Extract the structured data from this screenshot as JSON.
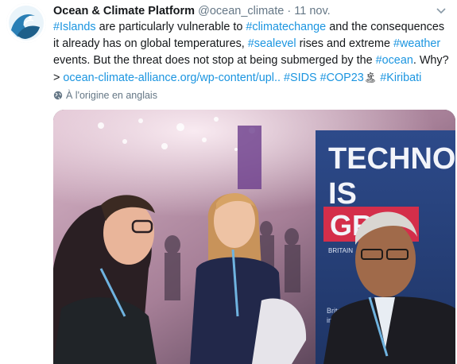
{
  "tweet": {
    "author_name": "Ocean & Climate Platform",
    "handle": "@ocean_climate",
    "separator": "·",
    "date": "11 nov.",
    "caret_icon": "chevron-down-icon",
    "text": {
      "t1": "#Islands",
      "t2": " are particularly vulnerable to ",
      "t3": "#climatechange",
      "t4": " and the consequences it already has on global temperatures, ",
      "t5": "#sealevel",
      "t6": " rises and extreme ",
      "t7": "#weather",
      "t8": " events. But the threat does not stop at being submerged by the ",
      "t9": "#ocean",
      "t10": ". Why? > ",
      "t11": "ocean-climate-alliance.org/wp-content/upl..",
      "t12": " ",
      "t13": "#SIDS",
      "t14": " ",
      "t15": "#COP23",
      "t16": "🏝",
      "t17": " ",
      "t18": "#Kiribati"
    },
    "translation": "À l'origine en anglais"
  },
  "media": {
    "sign_line1": "TECHNO",
    "sign_line2": "IS",
    "sign_line3": "GR",
    "sign_small1": "BRITAIN",
    "sign_small2": "Britain +",
    "sign_small3": "innovat"
  },
  "colors": {
    "link": "#1b95e0",
    "text": "#14171a",
    "muted": "#657786",
    "avatar_wave": "#2a7fb5"
  }
}
